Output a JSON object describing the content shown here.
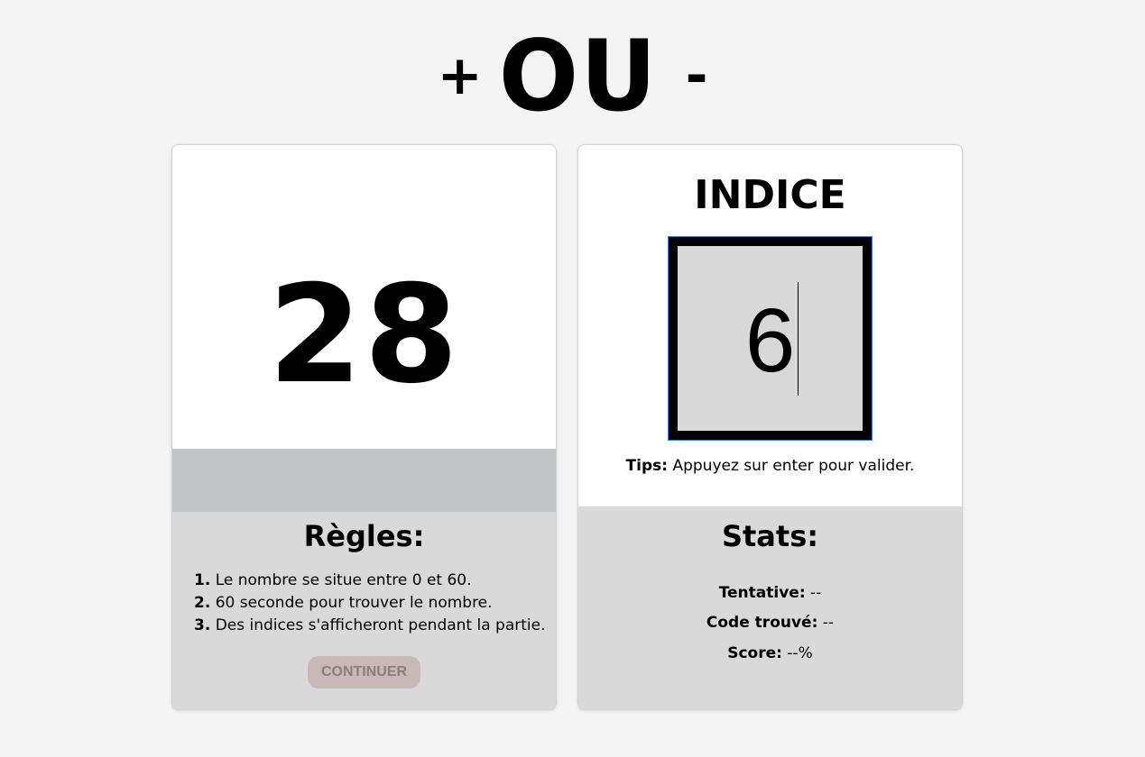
{
  "header": {
    "plus": "+",
    "ou": "OU",
    "minus": "-"
  },
  "game": {
    "number": "28",
    "rules_title": "Règles:",
    "rules": [
      {
        "num": "1.",
        "text": "Le nombre se situe entre 0 et 60."
      },
      {
        "num": "2.",
        "text": "60 seconde pour trouver le nombre."
      },
      {
        "num": "3.",
        "text": "Des indices s'afficheront pendant la partie."
      }
    ],
    "continue_label": "CONTINUER"
  },
  "hint": {
    "title": "INDICE",
    "input_value": "6",
    "tips_label": "Tips:",
    "tips_text": "Appuyez sur enter pour valider."
  },
  "stats": {
    "title": "Stats:",
    "attempt_label": "Tentative:",
    "attempt_value": "--",
    "code_label": "Code trouvé:",
    "code_value": "--",
    "score_label": "Score:",
    "score_value": "--%"
  },
  "colors": {
    "background": "#f4f4f4",
    "card": "#ffffff",
    "panel": "#d9d9d9",
    "feedback_bar": "#c0c4c7",
    "input_bg": "#d8d8d8",
    "continue_button": "#c9b8b8",
    "continue_text": "#8a7d7d",
    "focus_ring": "#3d7de0"
  }
}
